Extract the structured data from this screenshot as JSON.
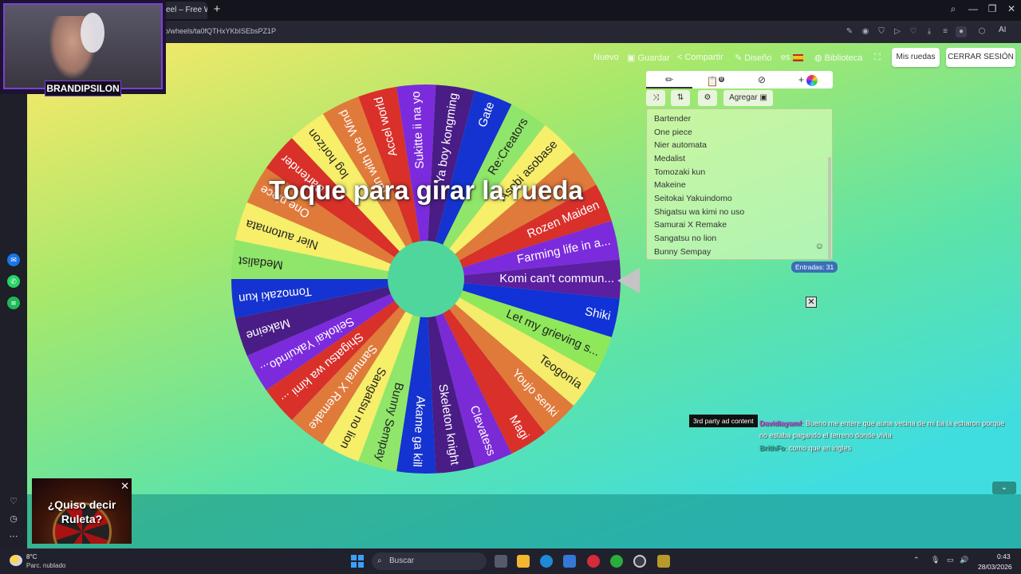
{
  "browser": {
    "tab_title": "eel – Free Wi",
    "url": "o/wheels/ta0fQTHxYKbISEbsPZ1P",
    "ai_label": "AI"
  },
  "stream": {
    "streamer_name": "BRANDIPSILON"
  },
  "nav": {
    "nuevo": "Nuevo",
    "guardar": "Guardar",
    "compartir": "Compartir",
    "diseno": "Diseño",
    "lang": "es",
    "biblioteca": "Biblioteca",
    "mis_ruedas": "Mis ruedas",
    "cerrar_sesion": "CERRAR SESIÓN"
  },
  "panel": {
    "badge_count": "8",
    "add_label": "Agregar",
    "entries": [
      "Bartender",
      "One piece",
      "Nier automata",
      "Medalist",
      "Tomozaki kun",
      "Makeine",
      "Seitokai Yakuindomo",
      "Shigatsu wa kimi no uso",
      "Samurai X Remake",
      "Sangatsu no lion",
      "Bunny Sempay"
    ],
    "entries_count": "Entradas: 31"
  },
  "wheel": {
    "spin_prompt": "Toque para girar la rueda",
    "center_color": "#4fd69c",
    "segments": [
      {
        "label": "Komi can't commun...",
        "color": "#5b1fa0"
      },
      {
        "label": "Shiki",
        "color": "#1032d6"
      },
      {
        "label": "Let my grieving s...",
        "color": "#8ee85a"
      },
      {
        "label": "Teogonía",
        "color": "#f4ec6a"
      },
      {
        "label": "Youjo senki",
        "color": "#e07a3a"
      },
      {
        "label": "Magi",
        "color": "#d9302a"
      },
      {
        "label": "Clevatess",
        "color": "#7a2bd6"
      },
      {
        "label": "Skeleton knight",
        "color": "#4a1c86"
      },
      {
        "label": "Akame ga kill",
        "color": "#1533d0"
      },
      {
        "label": "Bunny Sempay",
        "color": "#8fe66a"
      },
      {
        "label": "Sangatsu no lion",
        "color": "#f7ee6a"
      },
      {
        "label": "Samurai X Remake",
        "color": "#e07a3a"
      },
      {
        "label": "Shigatsu wa kimi ...",
        "color": "#d9302a"
      },
      {
        "label": "Seitokai Yakuindo...",
        "color": "#7b2bdc"
      },
      {
        "label": "Makeine",
        "color": "#4a1c86"
      },
      {
        "label": "Tomozaki kun",
        "color": "#1533d0"
      },
      {
        "label": "Medalist",
        "color": "#8fe66a"
      },
      {
        "label": "Nier automata",
        "color": "#f7ee6a"
      },
      {
        "label": "One piece",
        "color": "#e07a3a"
      },
      {
        "label": "Bartender",
        "color": "#d9302a"
      },
      {
        "label": "log horizon",
        "color": "#f7ee6a"
      },
      {
        "label": "run with the Wind",
        "color": "#e07a3a"
      },
      {
        "label": "Accel world",
        "color": "#d9302a"
      },
      {
        "label": "Sukitte ii na yo",
        "color": "#7b2bdc"
      },
      {
        "label": "Ya boy kongming",
        "color": "#4a1c86"
      },
      {
        "label": "Gate",
        "color": "#1533d0"
      },
      {
        "label": "Re:Creators",
        "color": "#8fe66a"
      },
      {
        "label": "Asobi asobase",
        "color": "#f7ee6a"
      },
      {
        "label": "",
        "color": "#e07a3a"
      },
      {
        "label": "Rozen Maiden",
        "color": "#d9302a"
      },
      {
        "label": "Farming life in a...",
        "color": "#7b2bdc"
      }
    ]
  },
  "chat": {
    "ad_tooltip": "3rd party ad content",
    "messages": [
      {
        "user": "Davidiayamf",
        "line1": "Bueno me entere que auna vecina de mi tia la echaron porque",
        "line2": "no estaba pagando el terreno donde vivia"
      },
      {
        "user": "BrithFo",
        "line1": "como que en ingles",
        "line2": ""
      }
    ]
  },
  "ad": {
    "text": "¿Quiso decir Ruleta?"
  },
  "taskbar": {
    "temp": "8°C",
    "weather": "Parc. nublado",
    "search_placeholder": "Buscar",
    "time": "0:43",
    "date": "28/03/2026"
  }
}
